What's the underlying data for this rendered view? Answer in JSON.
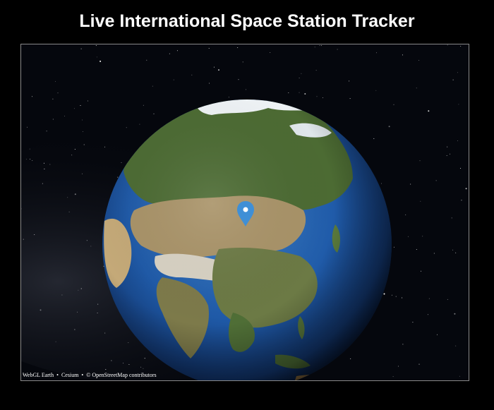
{
  "page": {
    "title": "Live International Space Station Tracker"
  },
  "viewer": {
    "credits": {
      "items": [
        "WebGL Earth",
        "Cesium",
        "© OpenStreetMap contributors"
      ],
      "separator": "•"
    },
    "marker": {
      "icon": "map-pin-icon",
      "color": "#3f8fd6"
    }
  },
  "colors": {
    "background": "#000000",
    "title": "#ffffff",
    "frame_border": "#8a8a8a",
    "ocean": "#1d4f9a",
    "land": "#4e6a34",
    "desert": "#b29a6b",
    "snow": "#eef2f5"
  }
}
